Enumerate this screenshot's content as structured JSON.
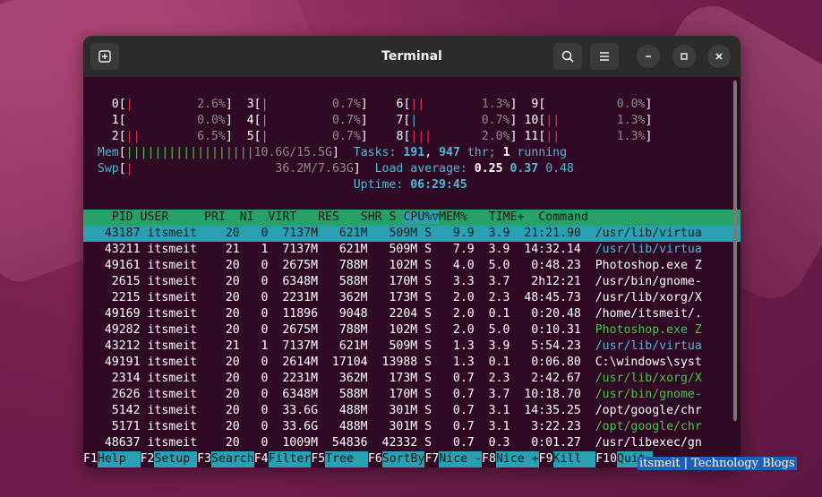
{
  "window": {
    "title": "Terminal"
  },
  "icons": {
    "new_tab": "new-tab-icon",
    "search": "search-icon",
    "menu": "hamburger-icon",
    "minimize": "minimize-icon",
    "maximize": "maximize-icon",
    "close": "close-icon"
  },
  "cpu_meters": [
    {
      "id": "0",
      "bar": "|",
      "pct": "2.6%"
    },
    {
      "id": "1",
      "bar": "",
      "pct": "0.0%"
    },
    {
      "id": "2",
      "bar": "||",
      "pct": "6.5%"
    },
    {
      "id": "3",
      "bar": "|",
      "pct": "0.7%"
    },
    {
      "id": "4",
      "bar": "|",
      "pct": "0.7%"
    },
    {
      "id": "5",
      "bar": "|",
      "pct": "0.7%"
    },
    {
      "id": "6",
      "bar": "||",
      "pct": "1.3%"
    },
    {
      "id": "7",
      "bar": "|",
      "pct": "0.7%"
    },
    {
      "id": "8",
      "bar": "|||",
      "pct": "2.0%"
    },
    {
      "id": "9",
      "bar": "",
      "pct": "0.0%"
    },
    {
      "id": "10",
      "bar": "||",
      "pct": "1.3%"
    },
    {
      "id": "11",
      "bar": "||",
      "pct": "1.3%"
    }
  ],
  "mem": {
    "label": "Mem",
    "bar": "||||||||||||||||||",
    "used": "10.6",
    "total": "G/15.5G"
  },
  "swp": {
    "label": "Swp",
    "bar": "|",
    "value": "36.2M/7.63G"
  },
  "tasks": {
    "label": "Tasks:",
    "count": "191",
    "thr": "947",
    "thr_label": "thr;",
    "running": "1",
    "running_label": "running"
  },
  "load": {
    "label": "Load average:",
    "l1": "0.25",
    "l5": "0.37",
    "l15": "0.48"
  },
  "uptime": {
    "label": "Uptime:",
    "value": "06:29:45"
  },
  "columns": [
    "PID",
    "USER",
    "PRI",
    "NI",
    "VIRT",
    "RES",
    "SHR",
    "S",
    "CPU%",
    "MEM%",
    "TIME+",
    "Command"
  ],
  "processes": [
    {
      "pid": "43187",
      "user": "itsmeit",
      "pri": "20",
      "ni": "0",
      "virt": "7137M",
      "res": "621M",
      "shr": "509M",
      "s": "S",
      "cpu": "9.9",
      "mem": "3.9",
      "time": "21:21.90",
      "cmd": "/usr/lib/virtua",
      "cmd_color": "cyan"
    },
    {
      "pid": "43211",
      "user": "itsmeit",
      "pri": "21",
      "ni": "1",
      "virt": "7137M",
      "res": "621M",
      "shr": "509M",
      "s": "S",
      "cpu": "7.9",
      "mem": "3.9",
      "time": "14:32.14",
      "cmd": "/usr/lib/virtua",
      "cmd_color": "cyan"
    },
    {
      "pid": "49161",
      "user": "itsmeit",
      "pri": "20",
      "ni": "0",
      "virt": "2675M",
      "res": "788M",
      "shr": "102M",
      "s": "S",
      "cpu": "4.0",
      "mem": "5.0",
      "time": "0:48.23",
      "cmd": "Photoshop.exe Z",
      "cmd_color": "white"
    },
    {
      "pid": "2615",
      "user": "itsmeit",
      "pri": "20",
      "ni": "0",
      "virt": "6348M",
      "res": "588M",
      "shr": "170M",
      "s": "S",
      "cpu": "3.3",
      "mem": "3.7",
      "time": "2h12:21",
      "cmd": "/usr/bin/gnome-",
      "cmd_color": "white"
    },
    {
      "pid": "2215",
      "user": "itsmeit",
      "pri": "20",
      "ni": "0",
      "virt": "2231M",
      "res": "362M",
      "shr": "173M",
      "s": "S",
      "cpu": "2.0",
      "mem": "2.3",
      "time": "48:45.73",
      "cmd": "/usr/lib/xorg/X",
      "cmd_color": "white"
    },
    {
      "pid": "49169",
      "user": "itsmeit",
      "pri": "20",
      "ni": "0",
      "virt": "11896",
      "res": "9048",
      "shr": "2204",
      "s": "S",
      "cpu": "2.0",
      "mem": "0.1",
      "time": "0:20.48",
      "cmd": "/home/itsmeit/.",
      "cmd_color": "white"
    },
    {
      "pid": "49282",
      "user": "itsmeit",
      "pri": "20",
      "ni": "0",
      "virt": "2675M",
      "res": "788M",
      "shr": "102M",
      "s": "S",
      "cpu": "2.0",
      "mem": "5.0",
      "time": "0:10.31",
      "cmd": "Photoshop.exe Z",
      "cmd_color": "green"
    },
    {
      "pid": "43212",
      "user": "itsmeit",
      "pri": "21",
      "ni": "1",
      "virt": "7137M",
      "res": "621M",
      "shr": "509M",
      "s": "S",
      "cpu": "1.3",
      "mem": "3.9",
      "time": "5:54.23",
      "cmd": "/usr/lib/virtua",
      "cmd_color": "cyan"
    },
    {
      "pid": "49191",
      "user": "itsmeit",
      "pri": "20",
      "ni": "0",
      "virt": "2614M",
      "res": "17104",
      "shr": "13988",
      "s": "S",
      "cpu": "1.3",
      "mem": "0.1",
      "time": "0:06.80",
      "cmd": "C:\\windows\\syst",
      "cmd_color": "white"
    },
    {
      "pid": "2314",
      "user": "itsmeit",
      "pri": "20",
      "ni": "0",
      "virt": "2231M",
      "res": "362M",
      "shr": "173M",
      "s": "S",
      "cpu": "0.7",
      "mem": "2.3",
      "time": "2:42.67",
      "cmd": "/usr/lib/xorg/X",
      "cmd_color": "green"
    },
    {
      "pid": "2626",
      "user": "itsmeit",
      "pri": "20",
      "ni": "0",
      "virt": "6348M",
      "res": "588M",
      "shr": "170M",
      "s": "S",
      "cpu": "0.7",
      "mem": "3.7",
      "time": "10:18.70",
      "cmd": "/usr/bin/gnome-",
      "cmd_color": "green"
    },
    {
      "pid": "5142",
      "user": "itsmeit",
      "pri": "20",
      "ni": "0",
      "virt": "33.6G",
      "res": "488M",
      "shr": "301M",
      "s": "S",
      "cpu": "0.7",
      "mem": "3.1",
      "time": "14:35.25",
      "cmd": "/opt/google/chr",
      "cmd_color": "white"
    },
    {
      "pid": "5171",
      "user": "itsmeit",
      "pri": "20",
      "ni": "0",
      "virt": "33.6G",
      "res": "488M",
      "shr": "301M",
      "s": "S",
      "cpu": "0.7",
      "mem": "3.1",
      "time": "3:22.23",
      "cmd": "/opt/google/chr",
      "cmd_color": "green"
    },
    {
      "pid": "48637",
      "user": "itsmeit",
      "pri": "20",
      "ni": "0",
      "virt": "1009M",
      "res": "54836",
      "shr": "42332",
      "s": "S",
      "cpu": "0.7",
      "mem": "0.3",
      "time": "0:01.27",
      "cmd": "/usr/libexec/gn",
      "cmd_color": "white"
    }
  ],
  "function_keys": [
    {
      "key": "F1",
      "label": "Help"
    },
    {
      "key": "F2",
      "label": "Setup"
    },
    {
      "key": "F3",
      "label": "Search"
    },
    {
      "key": "F4",
      "label": "Filter"
    },
    {
      "key": "F5",
      "label": "Tree"
    },
    {
      "key": "F6",
      "label": "SortBy"
    },
    {
      "key": "F7",
      "label": "Nice -"
    },
    {
      "key": "F8",
      "label": "Nice +"
    },
    {
      "key": "F9",
      "label": "Kill"
    },
    {
      "key": "F10",
      "label": "Quit"
    }
  ],
  "watermark": "itsmeit | Technology Blogs",
  "colors": {
    "terminal_bg": "#300a24",
    "header_green": "#26a269",
    "selected_cyan": "#2aa1b3",
    "titlebar": "#2b2b2b"
  }
}
